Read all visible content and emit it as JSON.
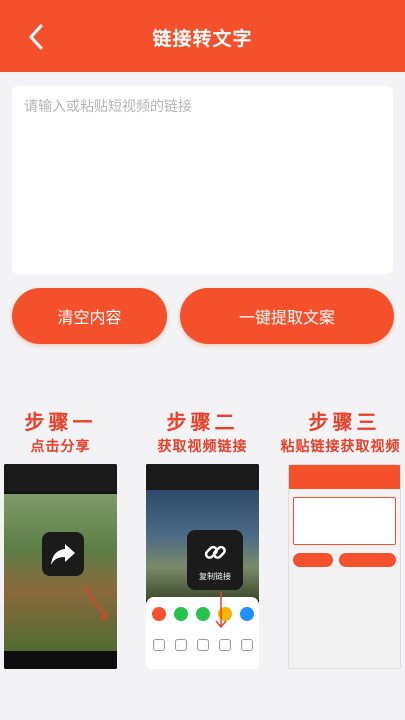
{
  "header": {
    "title": "链接转文字",
    "back_icon": "chevron-left-icon"
  },
  "input": {
    "placeholder": "请输入或粘贴短视频的链接",
    "value": ""
  },
  "buttons": {
    "clear": "清空内容",
    "extract": "一键提取文案"
  },
  "steps": [
    {
      "title": "步骤一",
      "subtitle": "点击分享"
    },
    {
      "title": "步骤二",
      "subtitle": "获取视频链接"
    },
    {
      "title": "步骤三",
      "subtitle": "粘贴链接获取视频"
    }
  ],
  "step2_image": {
    "copy_label": "复制链接"
  },
  "colors": {
    "primary": "#f4502b",
    "step_text": "#e8402a",
    "background": "#f3f3f5"
  }
}
